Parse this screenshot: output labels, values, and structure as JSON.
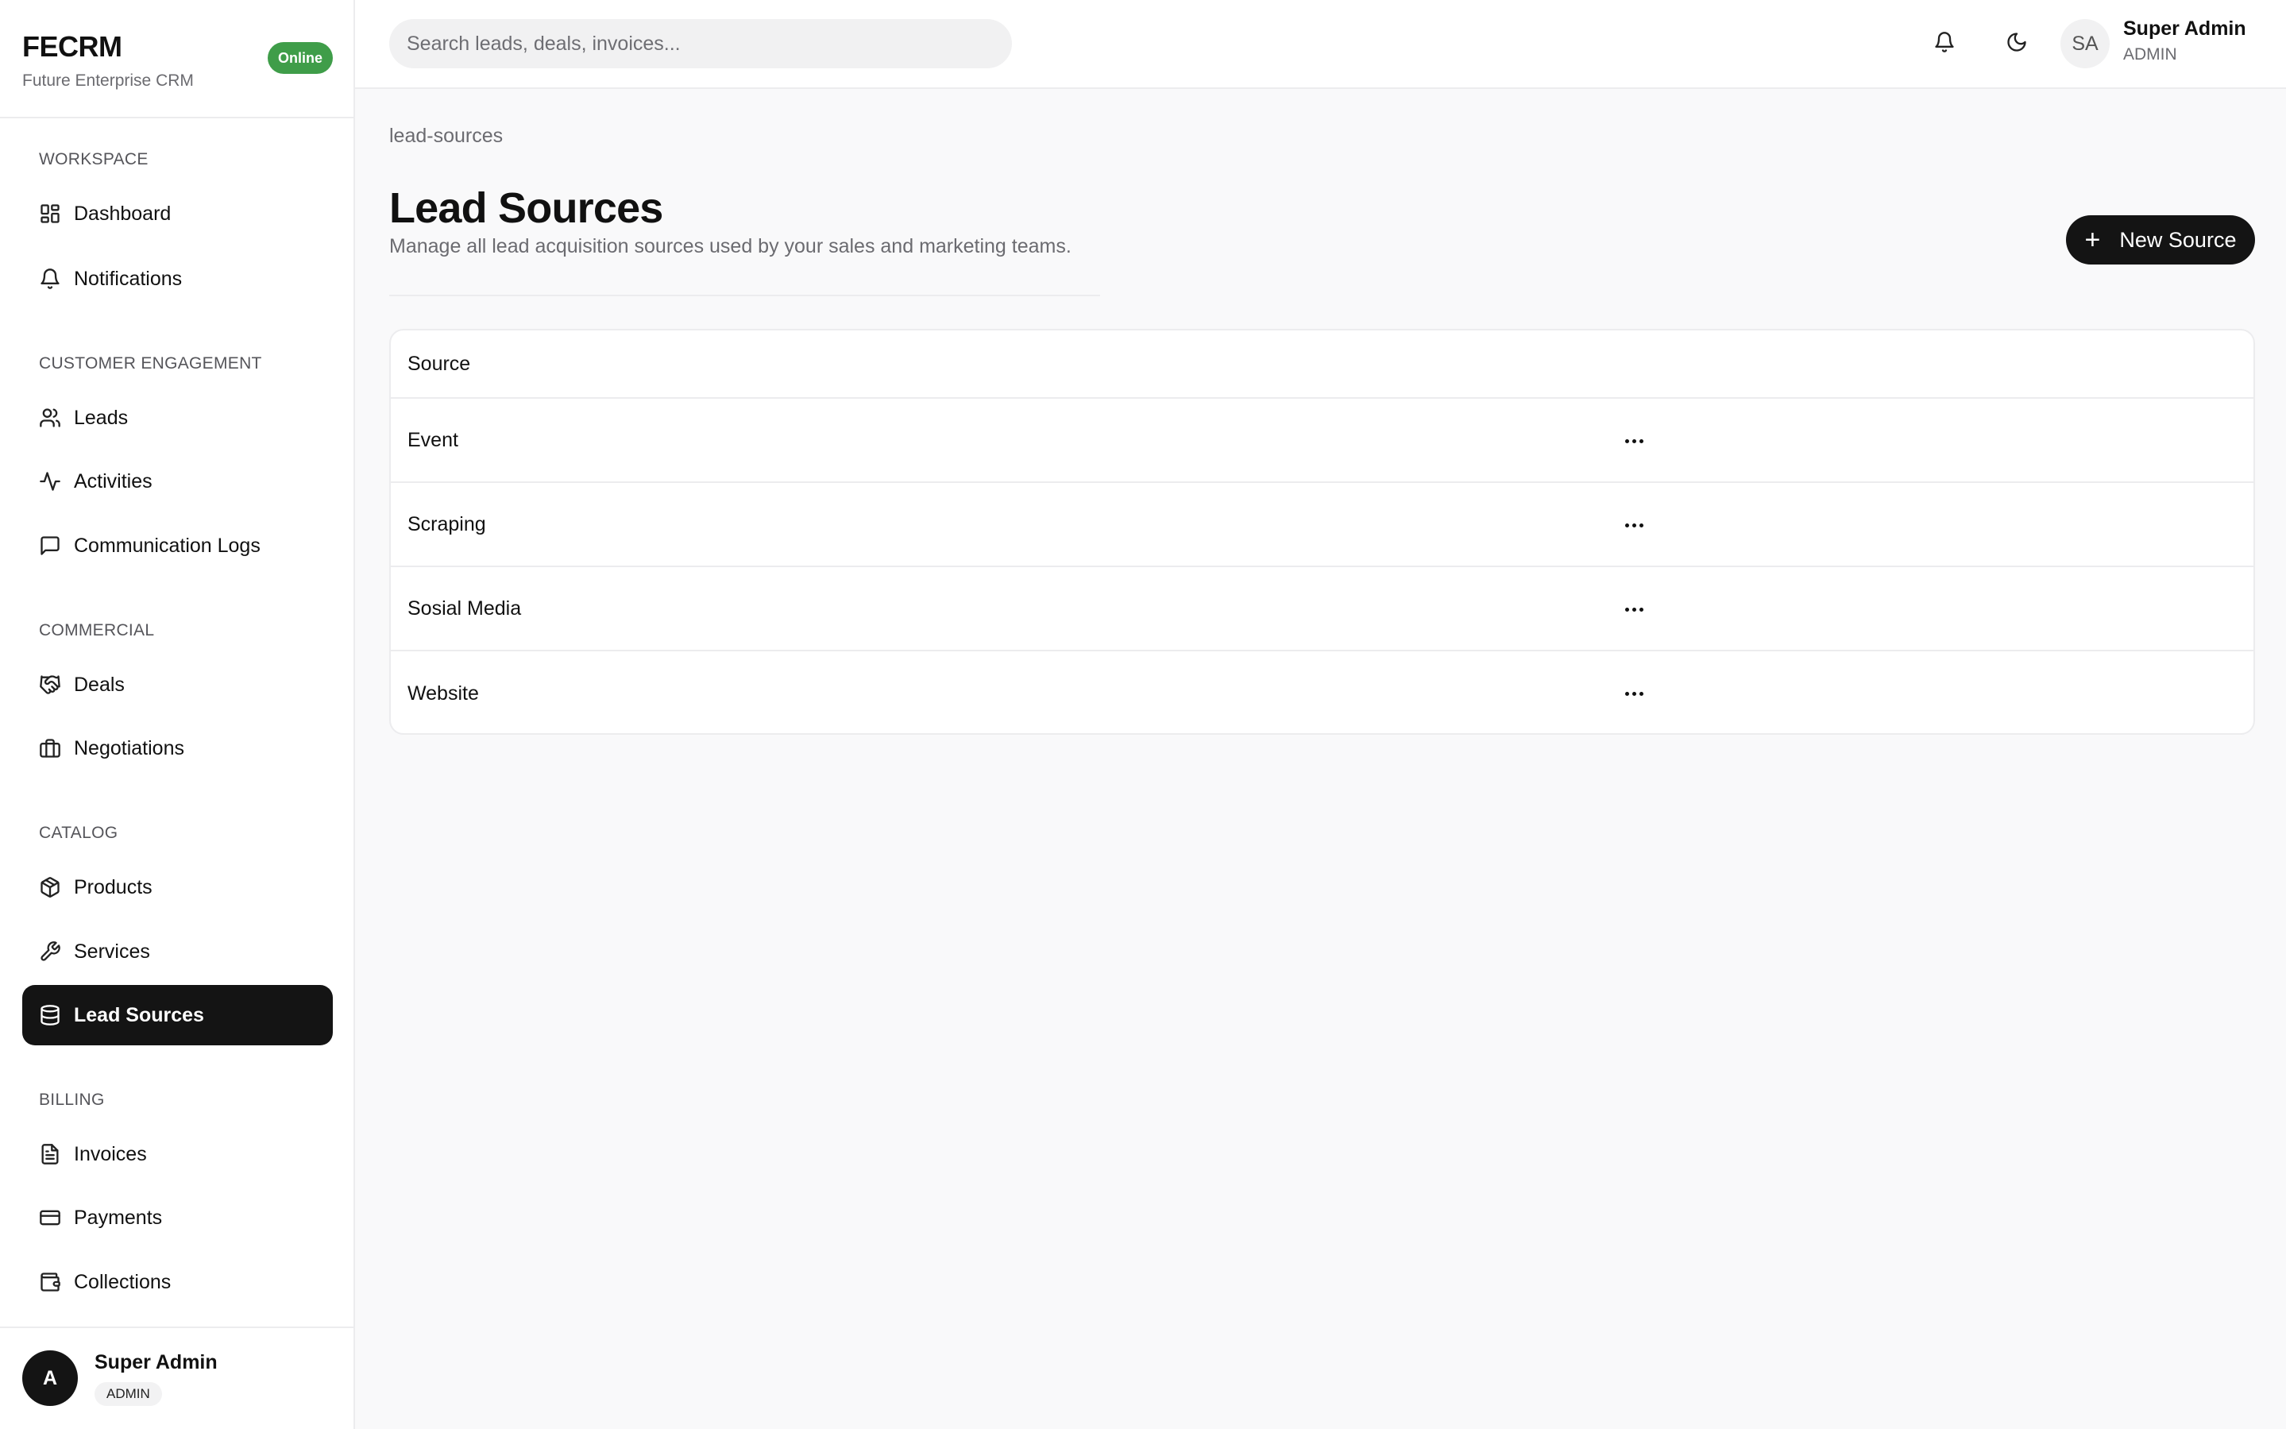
{
  "app": {
    "brand_name": "FECRM",
    "brand_subtitle": "Future Enterprise CRM",
    "status": "Online"
  },
  "sidebar": {
    "sections": {
      "workspace": "WORKSPACE",
      "customer_engagement": "CUSTOMER ENGAGEMENT",
      "commercial": "COMMERCIAL",
      "catalog": "CATALOG",
      "billing": "BILLING"
    },
    "items": [
      {
        "label": "Dashboard",
        "icon": "dashboard-icon"
      },
      {
        "label": "Notifications",
        "icon": "bell-icon"
      },
      {
        "label": "Leads",
        "icon": "users-icon"
      },
      {
        "label": "Activities",
        "icon": "activity-icon"
      },
      {
        "label": "Communication Logs",
        "icon": "message-icon"
      },
      {
        "label": "Deals",
        "icon": "handshake-icon"
      },
      {
        "label": "Negotiations",
        "icon": "briefcase-icon"
      },
      {
        "label": "Products",
        "icon": "package-icon"
      },
      {
        "label": "Services",
        "icon": "wrench-icon"
      },
      {
        "label": "Lead Sources",
        "icon": "database-icon",
        "active": true
      },
      {
        "label": "Invoices",
        "icon": "file-text-icon"
      },
      {
        "label": "Payments",
        "icon": "credit-card-icon"
      },
      {
        "label": "Collections",
        "icon": "wallet-icon"
      }
    ],
    "user": {
      "initial": "A",
      "name": "Super Admin",
      "role": "ADMIN"
    }
  },
  "topbar": {
    "search_placeholder": "Search leads, deals, invoices...",
    "avatar_initials": "SA",
    "user_name": "Super Admin",
    "user_role": "ADMIN"
  },
  "main": {
    "breadcrumb": "lead-sources",
    "title": "Lead Sources",
    "subtitle": "Manage all lead acquisition sources used by your sales and marketing teams.",
    "new_button_label": "New Source",
    "table": {
      "header": "Source",
      "rows": [
        "Event",
        "Scraping",
        "Sosial Media",
        "Website"
      ]
    }
  },
  "colors": {
    "accent": "#141414",
    "status_online": "#3f9d49",
    "page_bg": "#f9f9fa",
    "border": "#ececee"
  }
}
